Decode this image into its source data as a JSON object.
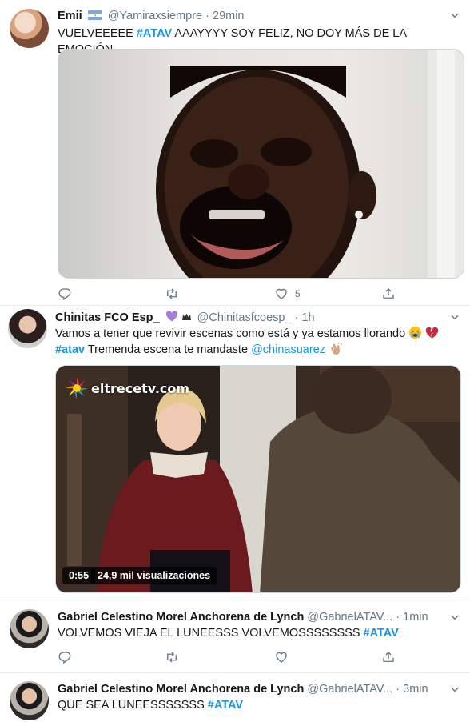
{
  "tweets": [
    {
      "name": "Emii",
      "handle": "@Yamiraxsiempre",
      "sep": "·",
      "time": "29min",
      "text_before": "VUELVEEEEE ",
      "hashtag": "#ATAV",
      "text_after": " AAAYYYY SOY FELIZ, NO DOY MÁS DE LA EMOCIÓN",
      "like_count": "5"
    },
    {
      "name": "Chinitas FCO Esp_",
      "handle": "@Chinitasfcoesp_",
      "sep": "·",
      "time": "1h",
      "line1": "Vamos a tener que revivir escenas como está y ya estamos llorando",
      "hashtag": "#atav",
      "line2": " Tremenda escena te mandaste ",
      "mention": "@chinasuarez",
      "watermark": "eltrecetv.com",
      "duration": "0:55",
      "views": "24,9 mil visualizaciones"
    },
    {
      "name": "Gabriel Celestino Morel Anchorena de Lynch",
      "handle": "@GabrielATAV...",
      "sep": "·",
      "time": "1min",
      "text_before": "VOLVEMOS VIEJA EL LUNEESSS VOLVEMOSSSSSSSS ",
      "hashtag": "#ATAV"
    },
    {
      "name": "Gabriel Celestino Morel Anchorena de Lynch",
      "handle": "@GabrielATAV...",
      "sep": "·",
      "time": "3min",
      "text_before": "QUE SEA LUNEESSSSSSS ",
      "hashtag": "#ATAV"
    }
  ],
  "colors": {
    "accent": "#1b95e0",
    "muted": "#657786",
    "border": "#e6ecf0"
  }
}
